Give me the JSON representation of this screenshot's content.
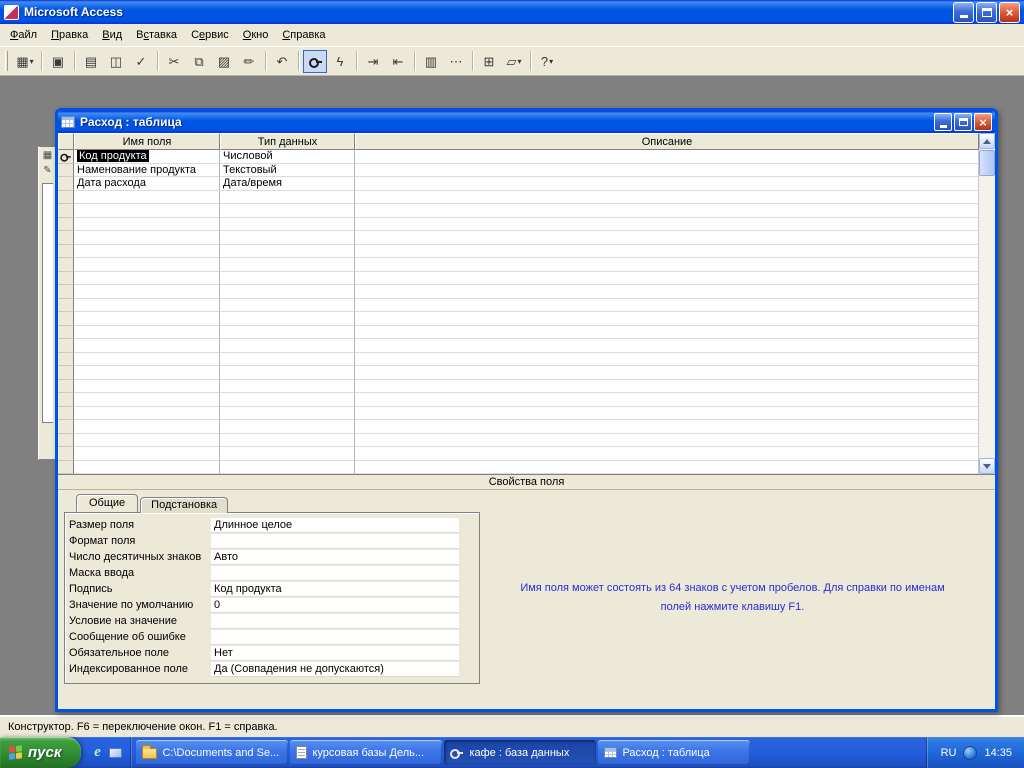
{
  "colors": {
    "titlebar_dark": "#0831D9",
    "titlebar_blue": "#0054E3",
    "titlebar_light": "#418CF0",
    "close_red": "#D6492B",
    "chrome": "#ECE9D8",
    "workspace_gray": "#808080",
    "taskbar_blue": "#245EDC",
    "start_green": "#2F8A2F",
    "help_text_blue": "#2B2BD5",
    "selection_highlight": "#000000"
  },
  "icons": {
    "close": "×",
    "dropdown": "▾",
    "background_window": [
      "▦",
      "✎"
    ]
  },
  "window": {
    "title": "Microsoft Access"
  },
  "menu": {
    "items": [
      {
        "name": "file",
        "label": "Файл",
        "accel": 0
      },
      {
        "name": "edit",
        "label": "Правка",
        "accel": 0
      },
      {
        "name": "view",
        "label": "Вид",
        "accel": 0
      },
      {
        "name": "insert",
        "label": "Вставка",
        "accel": 1
      },
      {
        "name": "tools",
        "label": "Сервис",
        "accel": 1
      },
      {
        "name": "window",
        "label": "Окно",
        "accel": 0
      },
      {
        "name": "help",
        "label": "Справка",
        "accel": 0
      }
    ]
  },
  "toolbar": {
    "buttons": [
      {
        "name": "view",
        "glyph": "▦",
        "dropdown": true
      },
      {
        "name": "save",
        "glyph": "▣",
        "sep_before": true
      },
      {
        "name": "print",
        "glyph": "▤",
        "sep_before": true
      },
      {
        "name": "print-preview",
        "glyph": "◫"
      },
      {
        "name": "spelling",
        "glyph": "✓"
      },
      {
        "name": "cut",
        "glyph": "✂",
        "sep_before": true
      },
      {
        "name": "copy",
        "glyph": "⧉"
      },
      {
        "name": "paste",
        "glyph": "▨"
      },
      {
        "name": "format-painter",
        "glyph": "✏"
      },
      {
        "name": "undo",
        "glyph": "↶",
        "sep_before": true
      },
      {
        "name": "primary-key",
        "glyph": "KEY",
        "pressed": true,
        "sep_before": true
      },
      {
        "name": "indexes",
        "glyph": "ϟ"
      },
      {
        "name": "insert-rows",
        "glyph": "⇥",
        "sep_before": true
      },
      {
        "name": "delete-rows",
        "glyph": "⇤"
      },
      {
        "name": "properties",
        "glyph": "▥",
        "sep_before": true
      },
      {
        "name": "build",
        "glyph": "⋯"
      },
      {
        "name": "database-window",
        "glyph": "⊞",
        "sep_before": true
      },
      {
        "name": "new-object",
        "glyph": "▱",
        "dropdown": true
      },
      {
        "name": "help",
        "glyph": "?",
        "dropdown": true,
        "sep_before": true
      }
    ]
  },
  "child_window": {
    "title": "Расход : таблица",
    "grid": {
      "headers": [
        "Имя поля",
        "Тип данных",
        "Описание"
      ],
      "rows": [
        {
          "field": "Код продукта",
          "type": "Числовой",
          "desc": "",
          "primary": true,
          "selected": true
        },
        {
          "field": "Наменование продукта",
          "type": "Текстовый",
          "desc": ""
        },
        {
          "field": "Дата расхода",
          "type": "Дата/время",
          "desc": ""
        }
      ],
      "empty_rows": 21
    },
    "properties_divider": "Свойства поля",
    "tabs": [
      {
        "name": "general",
        "label": "Общие",
        "active": true
      },
      {
        "name": "lookup",
        "label": "Подстановка",
        "active": false
      }
    ],
    "properties": [
      {
        "label": "Размер поля",
        "value": "Длинное целое"
      },
      {
        "label": "Формат поля",
        "value": ""
      },
      {
        "label": "Число десятичных знаков",
        "value": "Авто"
      },
      {
        "label": "Маска ввода",
        "value": ""
      },
      {
        "label": "Подпись",
        "value": "Код продукта"
      },
      {
        "label": "Значение по умолчанию",
        "value": "0"
      },
      {
        "label": "Условие на значение",
        "value": ""
      },
      {
        "label": "Сообщение об ошибке",
        "value": ""
      },
      {
        "label": "Обязательное поле",
        "value": "Нет"
      },
      {
        "label": "Индексированное поле",
        "value": "Да (Совпадения не допускаются)"
      }
    ],
    "help_text": "Имя поля может состоять из 64 знаков с учетом пробелов.  Для справки по именам полей нажмите клавишу F1."
  },
  "statusbar": {
    "text": "Конструктор.  F6 = переключение окон.  F1 = справка."
  },
  "taskbar": {
    "start_label": "пуск",
    "quick_launch": [
      {
        "name": "internet-explorer",
        "glyph": "e"
      },
      {
        "name": "show-desktop",
        "glyph": ""
      }
    ],
    "buttons": [
      {
        "label": "C:\\Documents and Se...",
        "icon": "folder",
        "pressed": false
      },
      {
        "label": "курсовая базы Дель...",
        "icon": "document",
        "pressed": false
      },
      {
        "label": "кафе : база данных",
        "icon": "access",
        "pressed": true
      },
      {
        "label": "Расход : таблица",
        "icon": "table",
        "pressed": false
      }
    ],
    "tray": {
      "language": "RU",
      "time": "14:35"
    }
  }
}
